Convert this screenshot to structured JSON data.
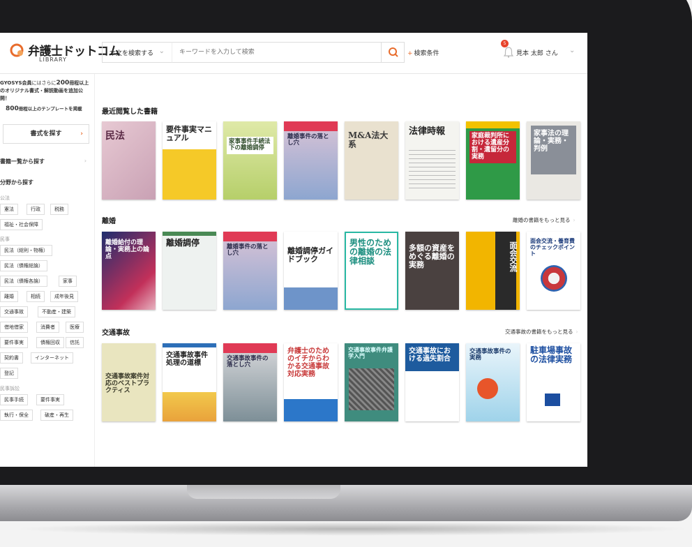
{
  "header": {
    "logo_text": "弁護士ドットコム",
    "logo_sub": "LIBRARY",
    "search_scope": "本文を検索する",
    "search_placeholder": "キーワードを入力して検索",
    "search_conditions": "検索条件",
    "notification_count": "5",
    "user_name": "見本 太郎 さん"
  },
  "sidebar": {
    "promo_prefix": "GYOSYS会員",
    "promo_middle": "にはさらに",
    "promo_count": "200",
    "promo_suffix": "冊程以上のオリジナル書式・解説動画を追加公開！",
    "template_count": "800",
    "template_text": "冊程以上のテンプレートを掲載",
    "find_button": "書式を探す",
    "book_list_link": "書籍一覧から探す",
    "field_title": "分野から探す",
    "categories": {
      "public": "公法",
      "civil": "民事",
      "civil_procedure": "民事訴訟"
    },
    "tags": {
      "constitution": "憲法",
      "administrative": "行政",
      "tax": "税務",
      "welfare": "福祉・社会保障",
      "civil_general": "民法（総則・物権）",
      "civil_obligations_general": "民法（債権総論）",
      "civil_obligations_specific": "民法（債権各論）",
      "family": "家事",
      "divorce": "離婚",
      "inheritance": "相続",
      "guardianship": "成年後見",
      "traffic": "交通事故",
      "real_estate": "不動産・建築",
      "lease": "借地借家",
      "consumer": "消費者",
      "medical": "医療",
      "elements": "要件事実",
      "debt_collection": "債権回収",
      "trust": "信託",
      "contracts": "契約書",
      "internet": "インターネット",
      "registration": "登記",
      "civil_procedure_tag": "民事手続",
      "elements2": "要件事実",
      "execution": "執行・保全",
      "bankruptcy": "破産・再生"
    }
  },
  "sections": {
    "recent": "最近閲覧した書籍",
    "divorce": "離婚",
    "divorce_more": "離婚の書籍をもっと見る",
    "traffic": "交通事故",
    "traffic_more": "交通事故の書籍をもっと見る"
  },
  "books": {
    "r1": "民法",
    "r2": "要件事実マニュアル",
    "r3": "家事事件手続法下の離婚調停",
    "r4": "離婚事件の落とし穴",
    "r5": "M&A法大系",
    "r6": "法律時報",
    "r7": "家庭裁判所における遺産分割・遺留分の実務",
    "r8": "家事法の理論・実務・判例",
    "d1": "離婚給付の理論・実務上の論点",
    "d2": "離婚調停",
    "d3": "離婚事件の落とし穴",
    "d4": "離婚調停ガイドブック",
    "d5": "男性のための離婚の法律相談",
    "d6": "多額の資産をめぐる離婚の実務",
    "d7": "面会交流",
    "d8": "面会交流・養育費のチェックポイント",
    "t1": "交通事故案件対応のベストプラクティス",
    "t2": "交通事故事件処理の道標",
    "t3": "交通事故事件の落とし穴",
    "t4": "弁護士のためのイチからわかる交通事故対応実務",
    "t5": "交通事故事件弁護学入門",
    "t6": "交通事故における過失割合",
    "t7": "交通事故事件の実務",
    "t8": "駐車場事故の法律実務"
  },
  "colors": {
    "accent": "#e86c2c",
    "text": "#222222",
    "border": "#dddddd"
  }
}
